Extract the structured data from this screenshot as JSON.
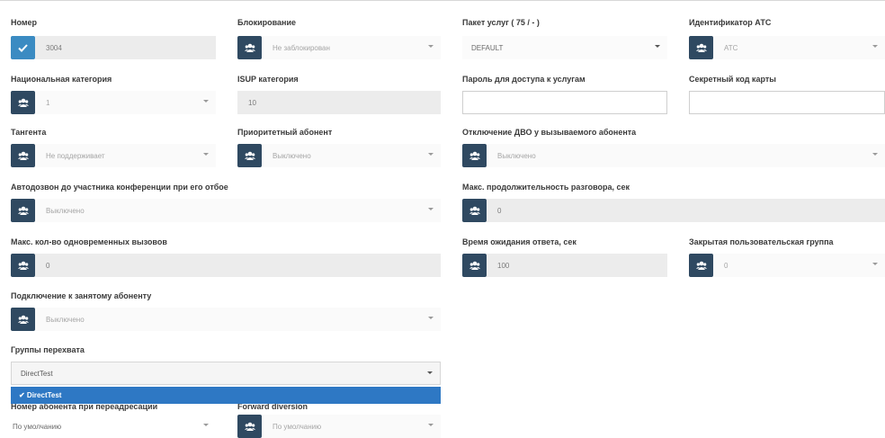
{
  "fields": {
    "number": {
      "label": "Номер",
      "value": "3004"
    },
    "blocking": {
      "label": "Блокирование",
      "value": "Не заблокирован"
    },
    "service_package": {
      "label": "Пакет услуг   ( 75 / - )",
      "value": "DEFAULT"
    },
    "pbx_id": {
      "label": "Идентификатор АТС",
      "value": "АТС"
    },
    "national_category": {
      "label": "Национальная категория",
      "value": "1"
    },
    "isup_category": {
      "label": "ISUP категория",
      "value": "10"
    },
    "service_password": {
      "label": "Пароль для доступа к услугам",
      "value": ""
    },
    "secret_card_code": {
      "label": "Секретный код карты",
      "value": ""
    },
    "tangent": {
      "label": "Тангента",
      "value": "Не поддерживает"
    },
    "priority_subscriber": {
      "label": "Приоритетный абонент",
      "value": "Выключено"
    },
    "disable_dvo": {
      "label": "Отключение ДВО у вызываемого абонента",
      "value": "Выключено"
    },
    "conf_autodial": {
      "label": "Автодозвон до участника конференции при его отбое",
      "value": "Выключено"
    },
    "max_duration": {
      "label": "Макс. продолжительность разговора, сек",
      "value": "0"
    },
    "max_calls": {
      "label": "Макс. кол-во одновременных вызовов",
      "value": "0"
    },
    "answer_wait": {
      "label": "Время ожидания ответа, сек",
      "value": "100"
    },
    "closed_user_group": {
      "label": "Закрытая пользовательская группа",
      "value": "0"
    },
    "busy_connect": {
      "label": "Подключение к занятому абоненту",
      "value": "Выключено"
    },
    "pickup_groups": {
      "label": "Группы перехвата",
      "value": "DirectTest"
    },
    "bottom_left": {
      "label": "Номер абонента при переадресации",
      "value": "По умолчанию"
    },
    "bottom_mid": {
      "label": "Forward diversion",
      "value": "По умолчанию"
    }
  },
  "dropdown": {
    "option": "✔  DirectTest"
  },
  "colors": {
    "button": "#2f4961",
    "button_checked": "#3b8bc2",
    "dropdown_selected": "#2e78c4"
  },
  "icons": {
    "field_button": "users-icon",
    "checked_button": "check-icon"
  }
}
